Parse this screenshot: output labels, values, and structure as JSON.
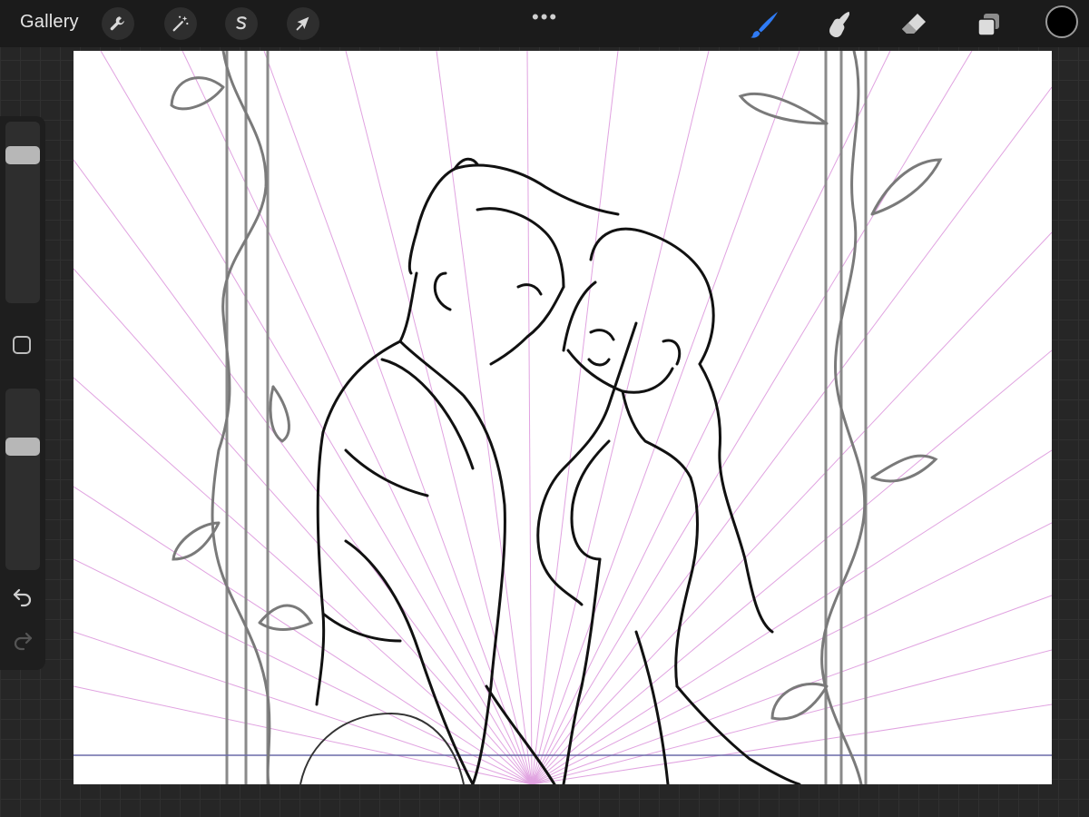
{
  "topbar": {
    "gallery_label": "Gallery",
    "left_tools": [
      {
        "name": "actions",
        "icon": "wrench-icon"
      },
      {
        "name": "adjustments",
        "icon": "magic-wand-icon"
      },
      {
        "name": "selection",
        "icon": "selection-s-icon"
      },
      {
        "name": "transform",
        "icon": "arrow-cursor-icon"
      }
    ],
    "more_label": "•••",
    "right_tools": [
      {
        "name": "brush",
        "icon": "brush-icon",
        "active": true
      },
      {
        "name": "smudge",
        "icon": "smudge-finger-icon",
        "active": false
      },
      {
        "name": "eraser",
        "icon": "eraser-icon",
        "active": false
      },
      {
        "name": "layers",
        "icon": "layers-icon",
        "active": false
      }
    ],
    "current_color": "#000000",
    "accent_color": "#2f7bf5"
  },
  "sidebar": {
    "brush_size_level": 0.15,
    "opacity_level": 0.3,
    "modify_icon": "square-outline-icon",
    "undo_icon": "undo-arrow-icon",
    "redo_icon": "redo-arrow-icon"
  },
  "canvas": {
    "background": "#ffffff",
    "guide_color": "#d98cd9",
    "sketch_color": "#111111",
    "frame_color": "#8a8a8a"
  }
}
